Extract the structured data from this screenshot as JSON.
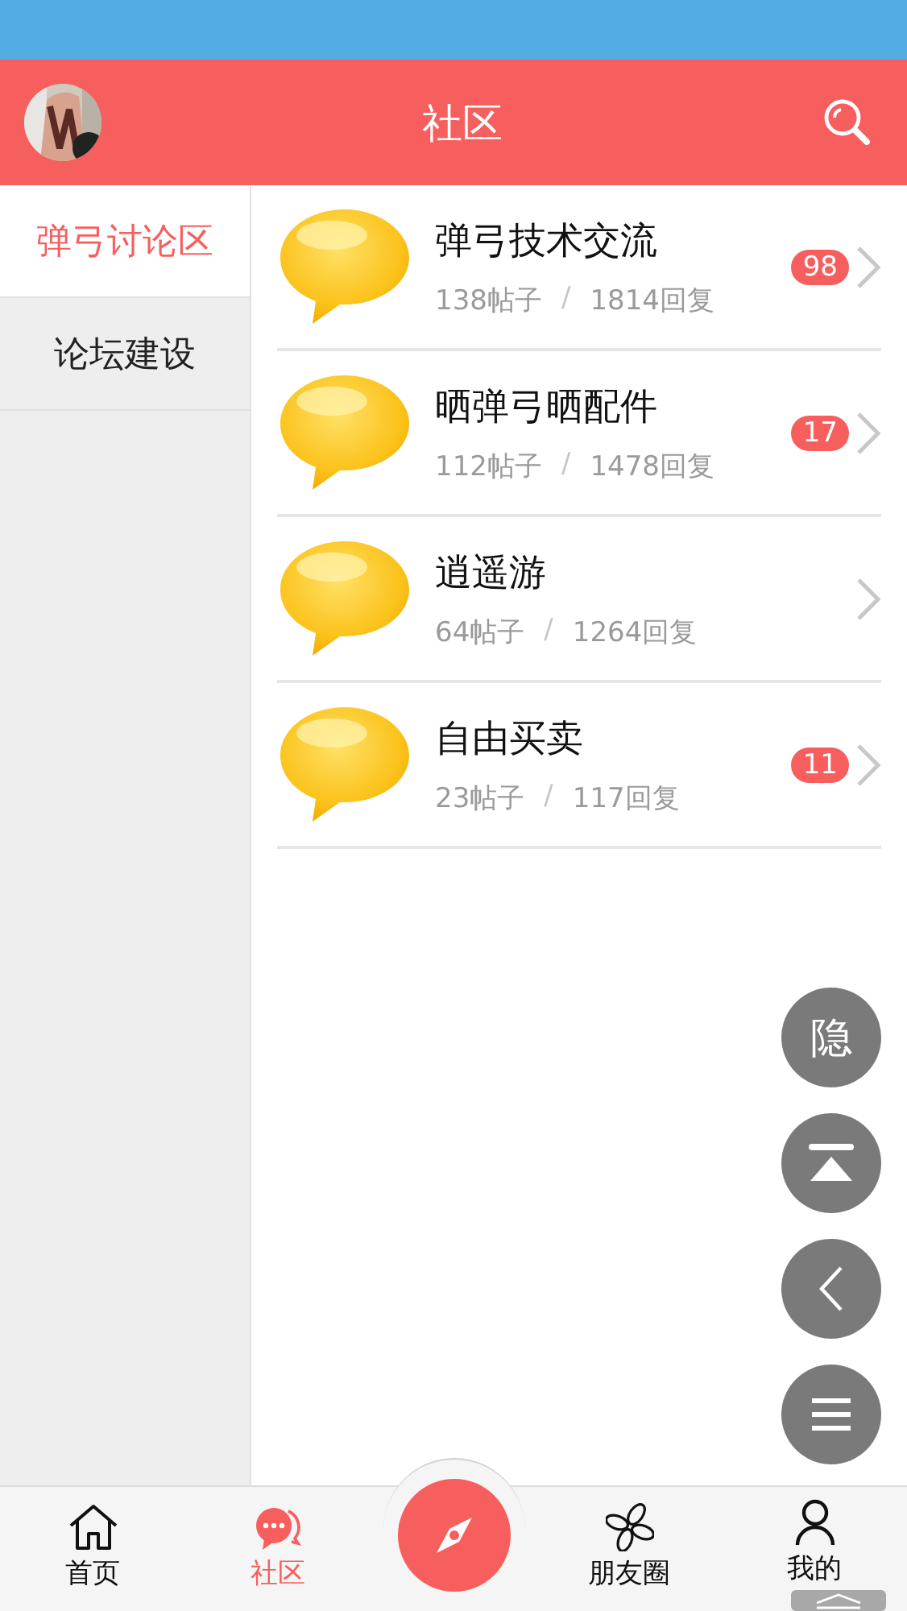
{
  "header": {
    "title": "社区"
  },
  "sidebar": {
    "items": [
      {
        "label": "弹弓讨论区",
        "selected": true
      },
      {
        "label": "论坛建设",
        "selected": false
      }
    ]
  },
  "forums": [
    {
      "name": "弹弓技术交流",
      "posts": "138帖子",
      "separator": "/",
      "replies": "1814回复",
      "badge": "98"
    },
    {
      "name": "晒弹弓晒配件",
      "posts": "112帖子",
      "separator": "/",
      "replies": "1478回复",
      "badge": "17"
    },
    {
      "name": "逍遥游",
      "posts": "64帖子",
      "separator": "/",
      "replies": "1264回复"
    },
    {
      "name": "自由买卖",
      "posts": "23帖子",
      "separator": "/",
      "replies": "117回复",
      "badge": "11"
    }
  ],
  "float_buttons": [
    {
      "kind": "text",
      "label": "隐"
    },
    {
      "kind": "top"
    },
    {
      "kind": "back"
    },
    {
      "kind": "menu"
    }
  ],
  "tabs": [
    {
      "kind": "home",
      "label": "首页",
      "selected": false
    },
    {
      "kind": "chat",
      "label": "社区",
      "selected": true
    },
    {
      "kind": "compass"
    },
    {
      "kind": "pinwheel",
      "label": "朋友圈",
      "selected": false
    },
    {
      "kind": "person",
      "label": "我的",
      "selected": false
    }
  ]
}
